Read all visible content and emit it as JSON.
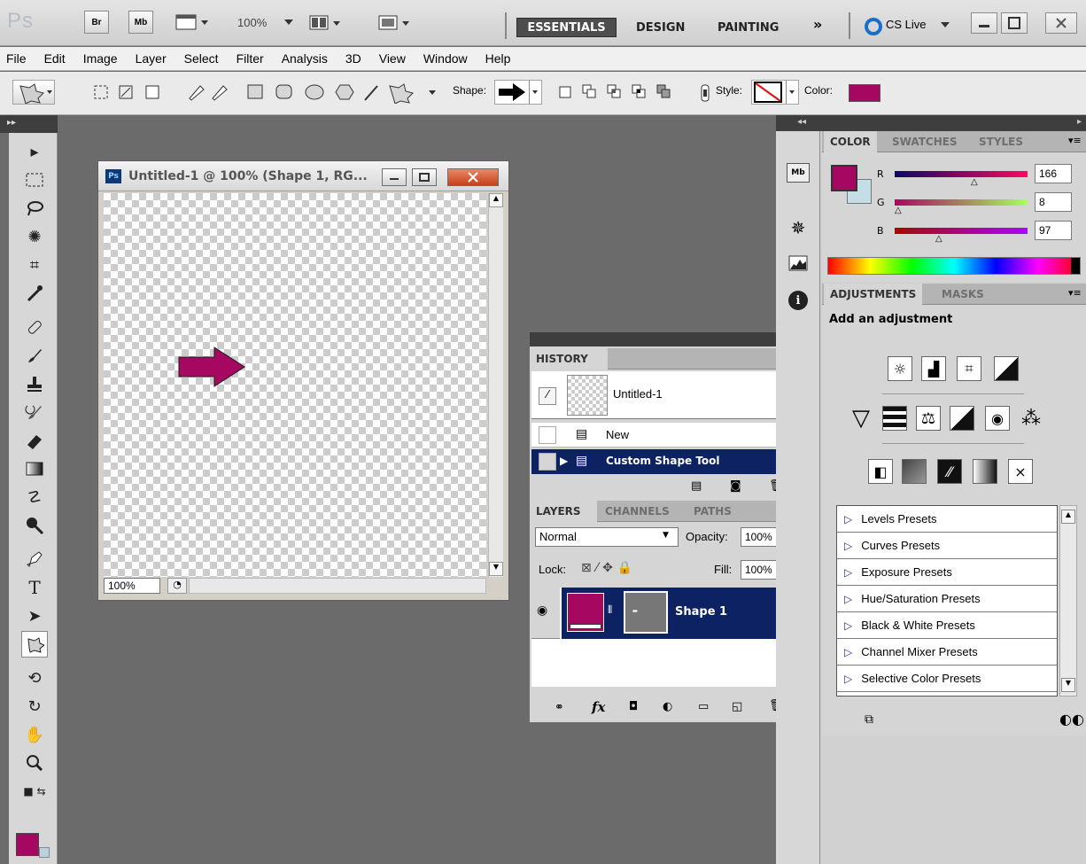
{
  "app": {
    "logo": "Ps",
    "br_label": "Br",
    "mb_label": "Mb",
    "zoom": "100%",
    "cs_live": "CS Live"
  },
  "workspaces": [
    "ESSENTIALS",
    "DESIGN",
    "PAINTING"
  ],
  "menus": [
    "File",
    "Edit",
    "Image",
    "Layer",
    "Select",
    "Filter",
    "Analysis",
    "3D",
    "View",
    "Window",
    "Help"
  ],
  "options": {
    "shape_label": "Shape:",
    "style_label": "Style:",
    "color_label": "Color:"
  },
  "colors": {
    "foreground": "#a60861",
    "accent": "#0c2263"
  },
  "document": {
    "title": "Untitled-1 @ 100% (Shape 1, RG...",
    "zoom": "100%"
  },
  "color_panel": {
    "tabs": [
      "COLOR",
      "SWATCHES",
      "STYLES"
    ],
    "channels": [
      {
        "label": "R",
        "value": "166"
      },
      {
        "label": "G",
        "value": "8"
      },
      {
        "label": "B",
        "value": "97"
      }
    ]
  },
  "adjustments": {
    "tabs": [
      "ADJUSTMENTS",
      "MASKS"
    ],
    "heading": "Add an adjustment",
    "presets": [
      "Levels Presets",
      "Curves Presets",
      "Exposure Presets",
      "Hue/Saturation Presets",
      "Black & White Presets",
      "Channel Mixer Presets",
      "Selective Color Presets"
    ]
  },
  "history": {
    "tab": "HISTORY",
    "snapshot": "Untitled-1",
    "steps": [
      "New",
      "Custom Shape Tool"
    ]
  },
  "layers": {
    "tabs": [
      "LAYERS",
      "CHANNELS",
      "PATHS"
    ],
    "blend_mode": "Normal",
    "opacity_label": "Opacity:",
    "opacity": "100%",
    "lock_label": "Lock:",
    "fill_label": "Fill:",
    "fill": "100%",
    "layer_name": "Shape 1"
  }
}
